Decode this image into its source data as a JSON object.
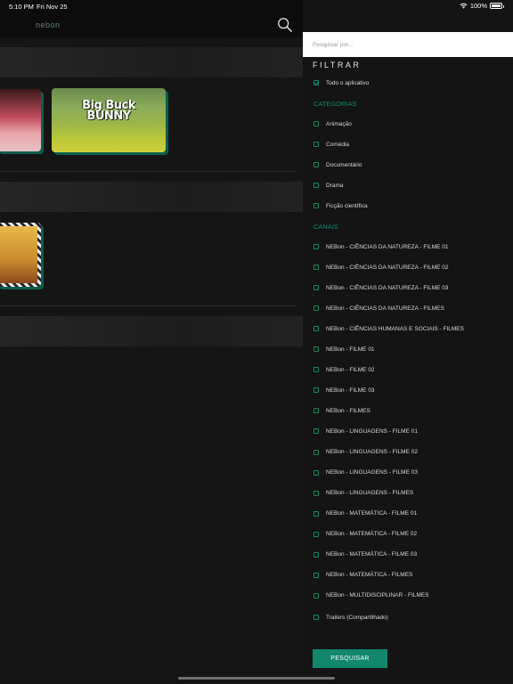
{
  "status": {
    "time": "5:10 PM",
    "date": "Fri Nov 25",
    "battery": "100%"
  },
  "header": {
    "logo_pre": "neb",
    "logo_o": "o",
    "logo_post": "n"
  },
  "cards": {
    "card2_title_line1": "Big Buck",
    "card2_title_line2": "BUNNY"
  },
  "drawer": {
    "search_placeholder": "Pesquisar por...",
    "filter_title": "FILTRAR",
    "all_app": {
      "label": "Todo o aplicativo",
      "checked": true
    },
    "categories_title": "CATEGORIAS",
    "categories": [
      "Animação",
      "Comédia",
      "Documentário",
      "Drama",
      "Ficção científica"
    ],
    "channels_title": "CANAIS",
    "channels": [
      "NEBon - CIÊNCIAS DA NATUREZA - FILME 01",
      "NEBon - CIÊNCIAS DA NATUREZA - FILME 02",
      "NEBon - CIÊNCIAS DA NATUREZA - FILME 03",
      "NEBon - CIÊNCIAS DA NATUREZA - FILMES",
      "NEBon - CIÊNCIAS HUMANAS E SOCIAIS - FILMES",
      "NEBon - FILME 01",
      "NEBon - FILME 02",
      "NEBon - FILME 03",
      "NEBon - FILMES",
      "NEBon - LINGUAGENS - FILME 01",
      "NEBon - LINGUAGENS - FILME 02",
      "NEBon - LINGUAGENS - FILME 03",
      "NEBon - LINGUAGENS - FILMES",
      "NEBon - MATEMÁTICA - FILME 01",
      "NEBon - MATEMÁTICA - FILME 02",
      "NEBon - MATEMÁTICA - FILME 03",
      "NEBon - MATEMÁTICA - FILMES",
      "NEBon - MULTIDISCIPLINAR - FILMES",
      "Trailers (Compartilhado)"
    ],
    "search_button": "PESQUISAR"
  },
  "colors": {
    "accent": "#12876b",
    "drawer_bg": "#141414",
    "header_bg": "#0c0c0c"
  }
}
